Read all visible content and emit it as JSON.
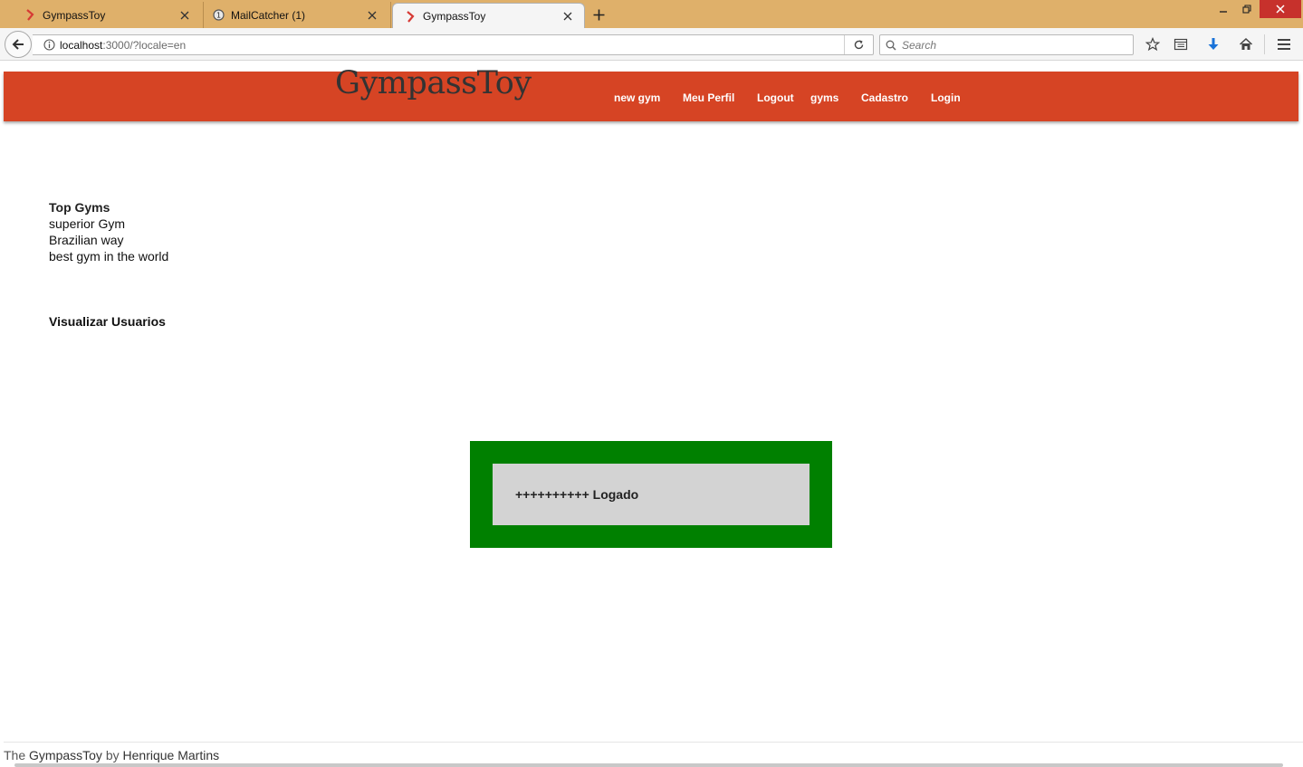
{
  "browser": {
    "tabs": [
      {
        "title": "GympassToy",
        "icon": "rails-icon"
      },
      {
        "title": "MailCatcher (1)",
        "icon": "mailcatcher-icon"
      },
      {
        "title": "GympassToy",
        "icon": "rails-icon"
      }
    ],
    "active_tab": 2,
    "url_host": "localhost",
    "url_path": ":3000/?locale=en",
    "search_placeholder": "Search"
  },
  "header": {
    "site_title": "GympassToy",
    "nav": [
      "new gym",
      "Meu Perfil",
      "Logout",
      "gyms",
      "Cadastro",
      "Login"
    ],
    "color": "#d64424"
  },
  "main": {
    "top_gyms_title": "Top Gyms",
    "gyms": [
      "superior Gym",
      "Brazilian way",
      "best gym in the world"
    ],
    "users_link": "Visualizar Usuarios"
  },
  "notice": {
    "text": "++++++++++ Logado",
    "border_color": "#008000",
    "bg_color": "#d3d3d3"
  },
  "footer": {
    "prefix": "The ",
    "app": "GympassToy",
    "middle": " by ",
    "author": "Henrique Martins"
  }
}
